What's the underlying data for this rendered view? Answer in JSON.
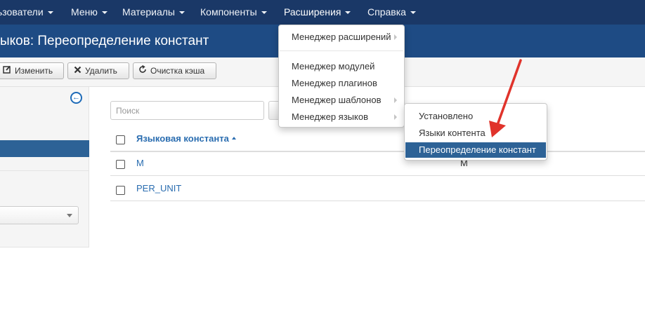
{
  "navbar": {
    "items": [
      {
        "label": "ьзователи"
      },
      {
        "label": "Меню"
      },
      {
        "label": "Материалы"
      },
      {
        "label": "Компоненты"
      },
      {
        "label": "Расширения"
      },
      {
        "label": "Справка"
      }
    ],
    "active_item": "Расширения"
  },
  "header": {
    "title": "ыков: Переопределение констант"
  },
  "toolbar": {
    "edit_label": "Изменить",
    "delete_label": "Удалить",
    "clear_cache_label": "Очистка кэша"
  },
  "sidebar": {
    "collapse_icon": "arrow-circle-left-icon",
    "filter_select_value": ""
  },
  "search": {
    "placeholder": "Поиск"
  },
  "table": {
    "columns": [
      {
        "label": "Языковая константа",
        "sort": "ascending"
      }
    ],
    "rows": [
      {
        "constant": "M",
        "text": "M"
      },
      {
        "constant": "PER_UNIT",
        "text": ""
      }
    ]
  },
  "extensions_menu": {
    "items": [
      {
        "label": "Менеджер расширений",
        "has_submenu": true
      },
      {
        "label": "Менеджер модулей",
        "has_submenu": false
      },
      {
        "label": "Менеджер плагинов",
        "has_submenu": false
      },
      {
        "label": "Менеджер шаблонов",
        "has_submenu": true
      },
      {
        "label": "Менеджер языков",
        "has_submenu": true
      }
    ]
  },
  "languages_submenu": {
    "items": [
      {
        "label": "Установлено",
        "active": false
      },
      {
        "label": "Языки контента",
        "active": false
      },
      {
        "label": "Переопределение констант",
        "active": true
      }
    ]
  },
  "colors": {
    "navbar": "#1a3867",
    "titlebar": "#1e4b84",
    "link": "#2a6db0",
    "active_item": "#2d6296",
    "annotation_arrow": "#e0332b"
  }
}
